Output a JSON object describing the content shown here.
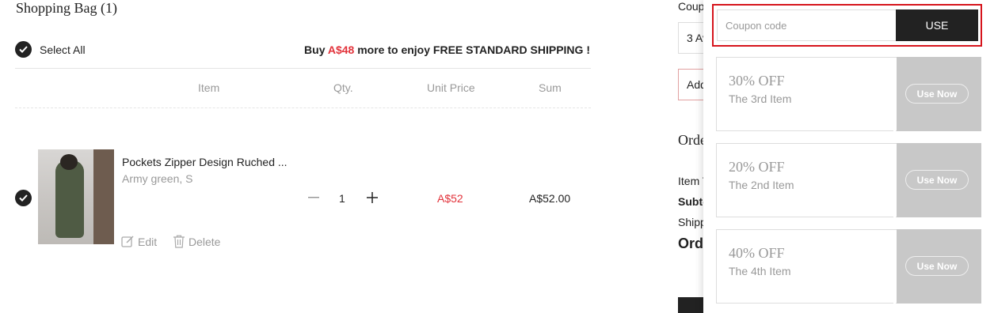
{
  "bag": {
    "title": "Shopping Bag (1)",
    "select_all": "Select All",
    "shipping_prefix": "Buy",
    "shipping_amount": "A$48",
    "shipping_suffix": "more to enjoy FREE STANDARD SHIPPING !"
  },
  "columns": [
    "Item",
    "Qty.",
    "Unit Price",
    "Sum"
  ],
  "item": {
    "name": "Pockets Zipper Design Ruched ...",
    "attributes": "Army green, S",
    "qty": "1",
    "unit_price": "A$52",
    "sum": "A$52.00",
    "edit_label": "Edit",
    "delete_label": "Delete",
    "image_icon": "product-photo"
  },
  "summary": {
    "coupon_label": "Coupo",
    "select_value": "3 Av",
    "add_label": "Add",
    "order_heading": "Orde",
    "item_total": "Item T",
    "subtotal": "Subto",
    "shipping": "Shipp",
    "order_total": "Orde"
  },
  "coupon_panel": {
    "placeholder": "Coupon code",
    "use_label": "USE",
    "coupons": [
      {
        "off": "30% OFF",
        "desc": "The 3rd Item",
        "action": "Use Now"
      },
      {
        "off": "20% OFF",
        "desc": "The 2nd Item",
        "action": "Use Now"
      },
      {
        "off": "40% OFF",
        "desc": "The 4th Item",
        "action": "Use Now"
      }
    ]
  },
  "colors": {
    "accent_red": "#e2323a",
    "highlight_border": "#d6141c",
    "dark": "#222222",
    "coupon_stub": "#c8c8c8"
  }
}
